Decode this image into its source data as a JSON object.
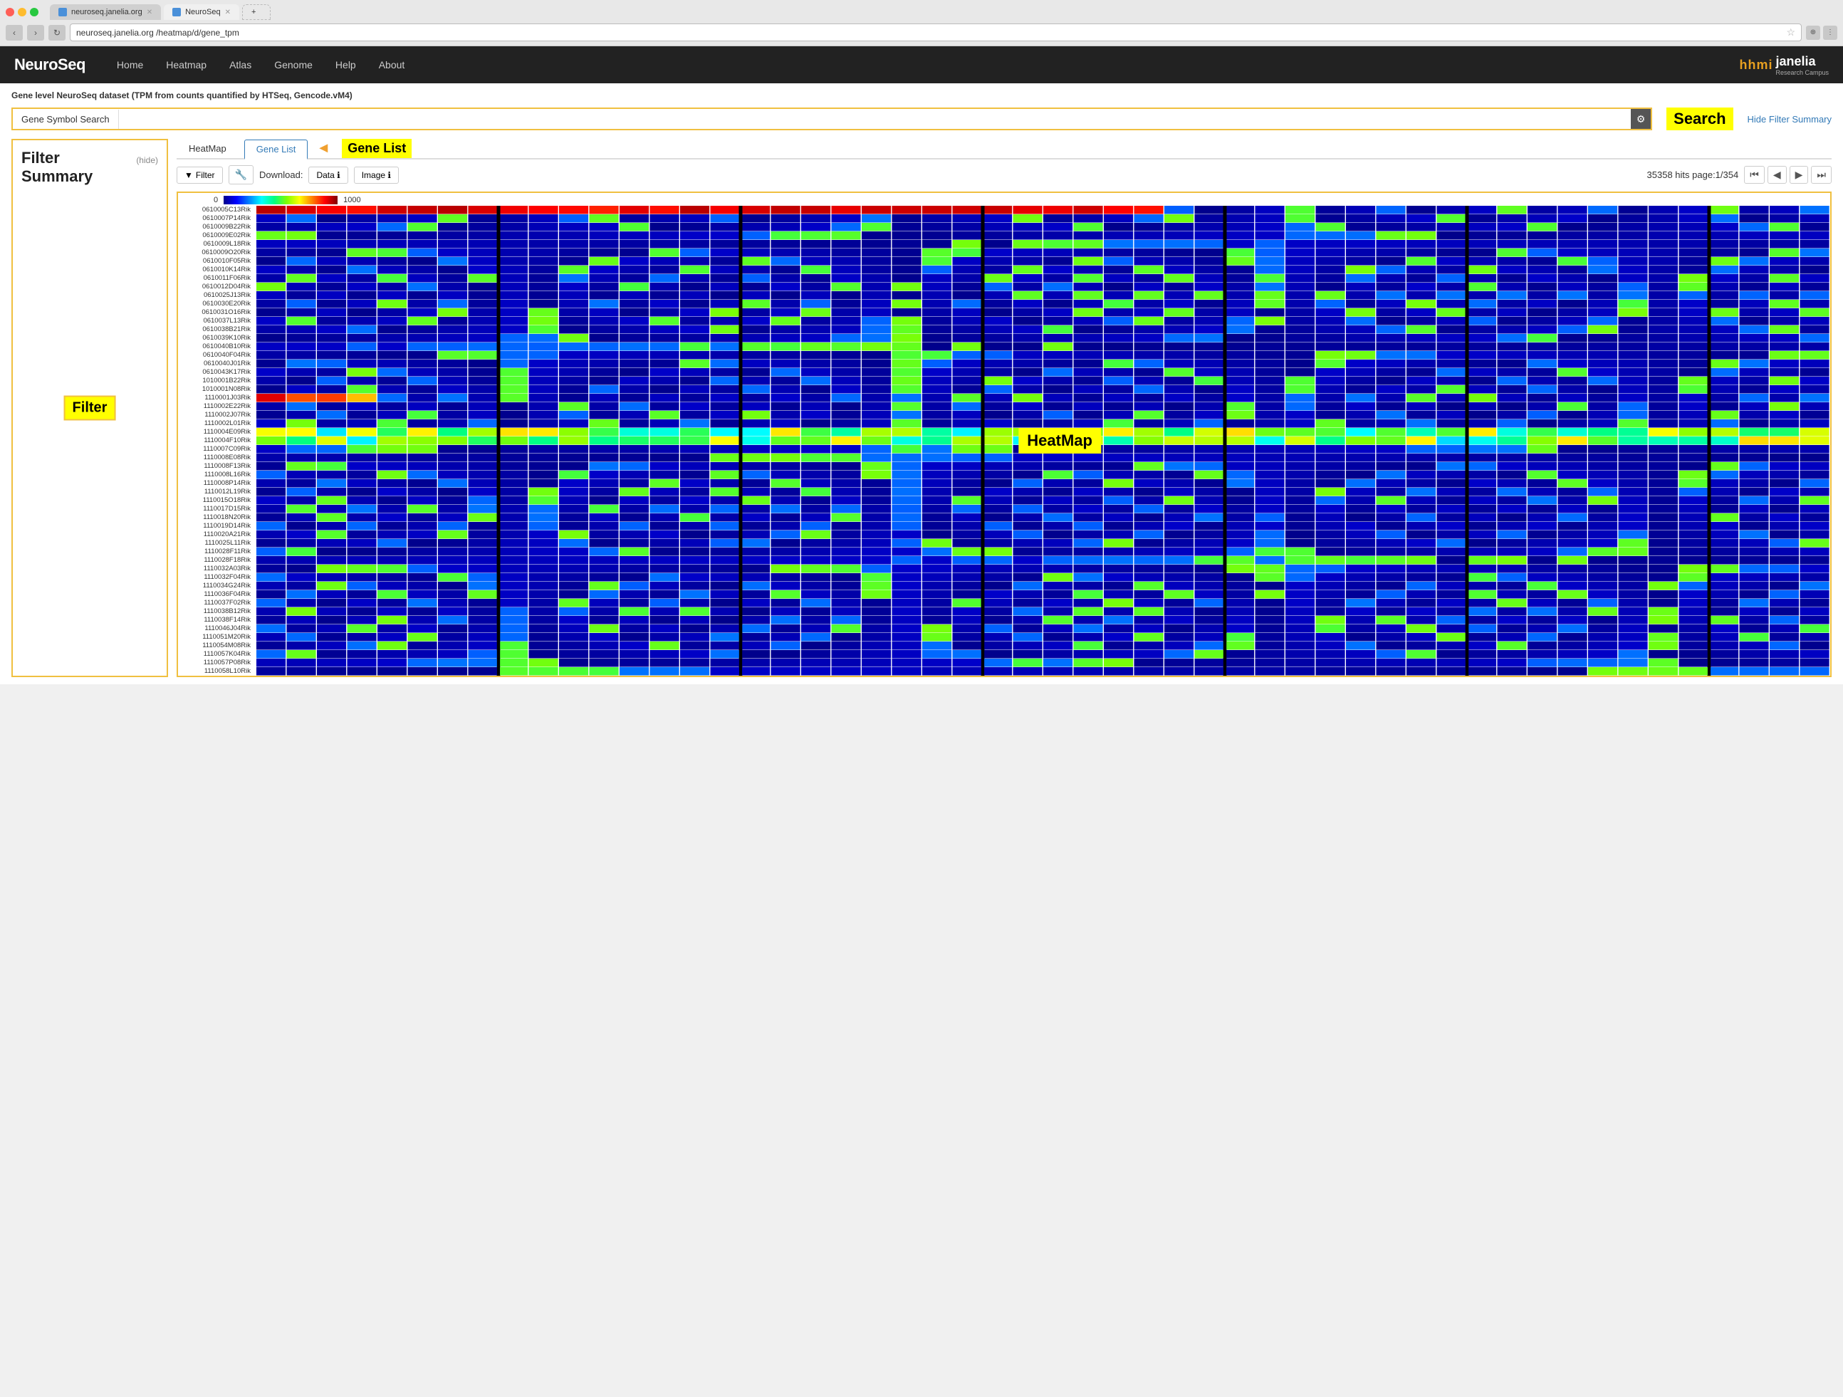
{
  "browser": {
    "tabs": [
      {
        "label": "neuroseq.janelia.org",
        "active": false
      },
      {
        "label": "NeuroSeq",
        "active": true
      }
    ],
    "url_prefix": "neuroseq.janelia.org",
    "url_path": "/heatmap/d/gene_tpm"
  },
  "navbar": {
    "logo": "NeuroSeq",
    "links": [
      "Home",
      "Heatmap",
      "Atlas",
      "Genome",
      "Help",
      "About"
    ],
    "brand_hhmi": "hhmi",
    "brand_janelia": "janelia",
    "brand_sub": "Research Campus"
  },
  "dataset_title": "Gene level NeuroSeq dataset (TPM from counts quantified by HTSeq, Gencode.vM4)",
  "search": {
    "label": "Gene Symbol Search",
    "placeholder": "",
    "value": "",
    "hide_filter_label": "Hide Filter Summary"
  },
  "tabs": [
    {
      "label": "HeatMap",
      "active": false
    },
    {
      "label": "Gene List",
      "active": true
    }
  ],
  "controls": {
    "filter_btn": "Filter",
    "download_label": "Download:",
    "data_btn": "Data ℹ",
    "image_btn": "Image ℹ",
    "hits_info": "35358 hits page:1/354"
  },
  "legend": {
    "min": "0",
    "max": "1000"
  },
  "filter_panel": {
    "title": "Filter Summary",
    "hide_label": "(hide)",
    "annotation": "Filter"
  },
  "heatmap_annotation": "HeatMap",
  "gene_list_annotation": "Gene List",
  "search_annotation": "Search",
  "genes": [
    "0610005C13Rik",
    "0610007P14Rik",
    "0610009B22Rik",
    "0610009E02Rik",
    "0610009L18Rik",
    "0610009O20Rik",
    "0610010F05Rik",
    "0610010K14Rik",
    "0610011F06Rik",
    "0610012D04Rik",
    "0610025J13Rik",
    "0610030E20Rik",
    "0610031O16Rik",
    "0610037L13Rik",
    "0610038B21Rik",
    "0610039K10Rik",
    "0610040B10Rik",
    "0610040F04Rik",
    "0610040J01Rik",
    "0610043K17Rik",
    "1010001B22Rik",
    "1010001N08Rik",
    "1110001J03Rik",
    "1110002E22Rik",
    "1110002J07Rik",
    "1110002L01Rik",
    "1110004E09Rik",
    "1110004F10Rik",
    "1110007C09Rik",
    "1110008E08Rik",
    "1110008F13Rik",
    "1110008L16Rik",
    "1110008P14Rik",
    "1110012L19Rik",
    "1110015O18Rik",
    "1110017D15Rik",
    "1110018N20Rik",
    "1110019D14Rik",
    "1110020A21Rik",
    "1110025L11Rik",
    "1110028F11Rik",
    "1110028F18Rik",
    "1110032A03Rik",
    "1110032F04Rik",
    "1110034G24Rik",
    "1110036F04Rik",
    "1110037F02Rik",
    "1110038B12Rik",
    "1110038F14Rik",
    "1110046J04Rik",
    "1110051M20Rik",
    "1110054M08Rik",
    "1110057K04Rik",
    "1110057P08Rik",
    "1110058L10Rik"
  ]
}
